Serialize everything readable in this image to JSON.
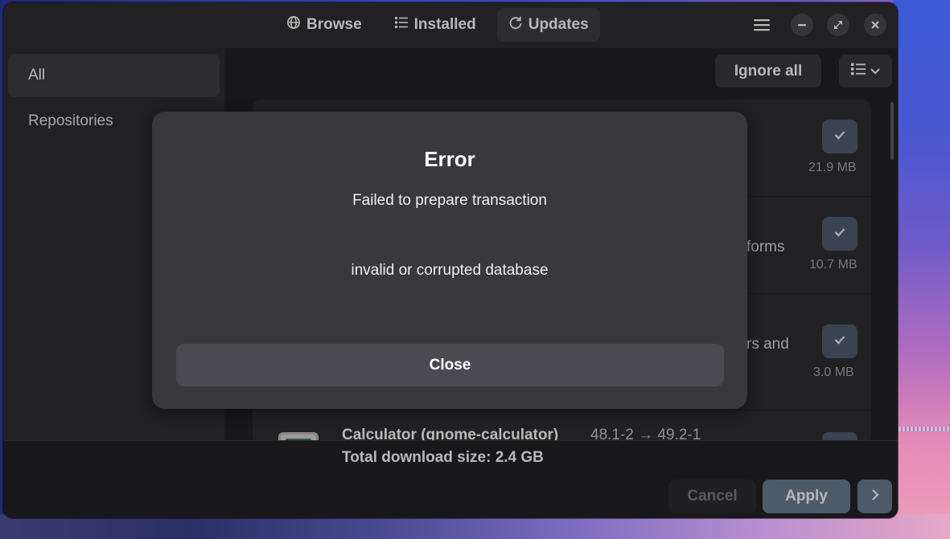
{
  "header": {
    "tabs": [
      {
        "label": "Browse",
        "icon": "globe-icon"
      },
      {
        "label": "Installed",
        "icon": "list-icon"
      },
      {
        "label": "Updates",
        "icon": "refresh-icon",
        "active": true
      }
    ],
    "window_controls": [
      "hamburger-menu-icon",
      "minimize-icon",
      "maximize-icon",
      "close-icon"
    ]
  },
  "sidebar": {
    "items": [
      {
        "label": "All",
        "active": true
      },
      {
        "label": "Repositories"
      }
    ]
  },
  "toolbar": {
    "ignore_all_label": "Ignore all",
    "view_icon": "list-view-icon"
  },
  "updates": {
    "rows": [
      {
        "size": "21.9 MB",
        "desc": "",
        "checked": true
      },
      {
        "size": "10.7 MB",
        "desc": "forms",
        "checked": true
      },
      {
        "size": "3.0 MB",
        "desc": "rs and",
        "checked": true
      },
      {
        "title": "Calculator (gnome-calculator)",
        "version": "48.1-2 → 49.2-1",
        "checked": true
      }
    ]
  },
  "footer": {
    "total": "Total download size: 2.4 GB",
    "cancel_label": "Cancel",
    "apply_label": "Apply"
  },
  "dialog": {
    "title": "Error",
    "message": "Failed to prepare transaction",
    "detail": "invalid or corrupted database",
    "close_label": "Close"
  },
  "colors": {
    "accent": "#6a7d93",
    "check_bg": "#4f5e72",
    "window_bg": "#222226",
    "dialog_bg": "#38383d"
  }
}
